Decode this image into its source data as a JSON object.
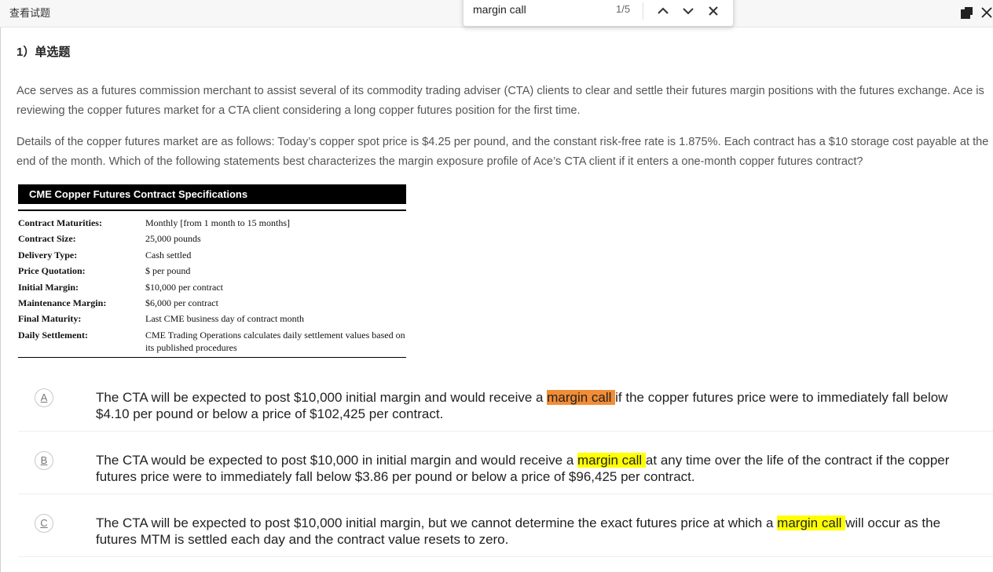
{
  "window": {
    "title": "查看试题"
  },
  "find": {
    "query": "margin call",
    "count": "1/5"
  },
  "question": {
    "heading": "1）单选题",
    "paragraph1": "Ace serves as a futures commission merchant to assist several of its commodity trading adviser (CTA) clients to clear and settle their futures margin positions with the futures exchange. Ace is reviewing the copper futures market for a CTA client considering a long copper futures position for the first time.",
    "paragraph2": "Details of the copper futures market are as follows: Today’s copper spot price is $4.25 per pound, and the constant risk-free rate is 1.875%. Each contract has a $10 storage cost payable at the end of the month. Which of the following statements best characterizes the margin exposure profile of Ace’s CTA client if it enters a one-month copper futures contract?"
  },
  "spec_table": {
    "title": "CME Copper Futures Contract Specifications",
    "rows": [
      {
        "label": "Contract Maturities:",
        "value": "Monthly [from 1 month to 15 months]"
      },
      {
        "label": "Contract Size:",
        "value": "25,000 pounds"
      },
      {
        "label": "Delivery Type:",
        "value": "Cash settled"
      },
      {
        "label": "Price Quotation:",
        "value": "$ per pound"
      },
      {
        "label": "Initial Margin:",
        "value": "$10,000 per contract"
      },
      {
        "label": "Maintenance Margin:",
        "value": "$6,000 per contract"
      },
      {
        "label": "Final Maturity:",
        "value": "Last CME business day of contract month"
      },
      {
        "label": "Daily Settlement:",
        "value": "CME Trading Operations calculates daily settlement values based on its published procedures"
      }
    ]
  },
  "options": [
    {
      "letter": "A",
      "before": "The CTA will be expected to post $10,000 initial margin and would receive a ",
      "highlight": "margin call ",
      "after": "if the copper futures price were to immediately fall below $4.10 per pound or below a price of $102,425 per contract."
    },
    {
      "letter": "B",
      "before": "The CTA would be expected to post $10,000 in initial margin and would receive a ",
      "highlight": "margin call ",
      "after": "at any time over the life of the contract if the copper futures price were to immediately fall below $3.86 per pound or below a price of $96,425 per contract."
    },
    {
      "letter": "C",
      "before": "The CTA will be expected to post $10,000 initial margin, but we cannot determine the exact futures price at which a ",
      "highlight": "margin call ",
      "after": "will occur as the futures MTM is settled each day and the contract value resets to zero."
    }
  ],
  "colors": {
    "current_match": "#f28c35",
    "match": "#ffff00",
    "titlebar": "#f7f7f7"
  },
  "icons": {
    "find_prev": "chevron-up-icon",
    "find_next": "chevron-down-icon",
    "find_close": "close-icon",
    "window_restore": "restore-window-icon",
    "window_close": "close-window-icon"
  }
}
